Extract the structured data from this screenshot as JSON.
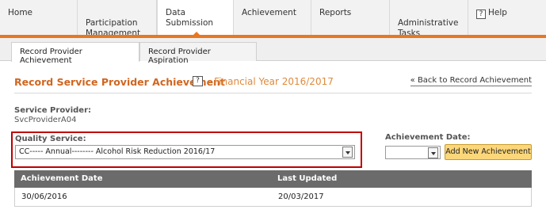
{
  "nav": {
    "items": [
      {
        "label": "Home"
      },
      {
        "label": "Participation\nManagement"
      },
      {
        "label": "Data Submission"
      },
      {
        "label": "Achievement"
      },
      {
        "label": "Reports"
      },
      {
        "label": "Administrative\nTasks"
      },
      {
        "label": "Help"
      }
    ],
    "help_glyph": "?"
  },
  "subtabs": [
    {
      "label": "Record Provider Achievement"
    },
    {
      "label": "Record Provider Aspiration"
    }
  ],
  "header": {
    "title": "Record Service Provider Achievement",
    "help_glyph": "?",
    "subtitle": "- Financial Year 2016/2017",
    "back_link": "« Back to Record Achievement"
  },
  "service_provider": {
    "label": "Service Provider:",
    "value": "SvcProviderA04"
  },
  "quality_service": {
    "label": "Quality Service:",
    "selected": "CC----- Annual-------- Alcohol Risk Reduction 2016/17"
  },
  "achievement_date": {
    "label": "Achievement Date:",
    "selected": ""
  },
  "add_button": "Add New Achievement",
  "table": {
    "columns": [
      "Achievement Date",
      "Last Updated"
    ],
    "rows": [
      [
        "30/06/2016",
        "20/03/2017"
      ]
    ]
  },
  "colors": {
    "accent_orange": "#e87722",
    "title_orange": "#d0661f",
    "highlight_red": "#c00000",
    "table_header": "#6b6b6b",
    "button_yellow": "#fcd77a"
  }
}
